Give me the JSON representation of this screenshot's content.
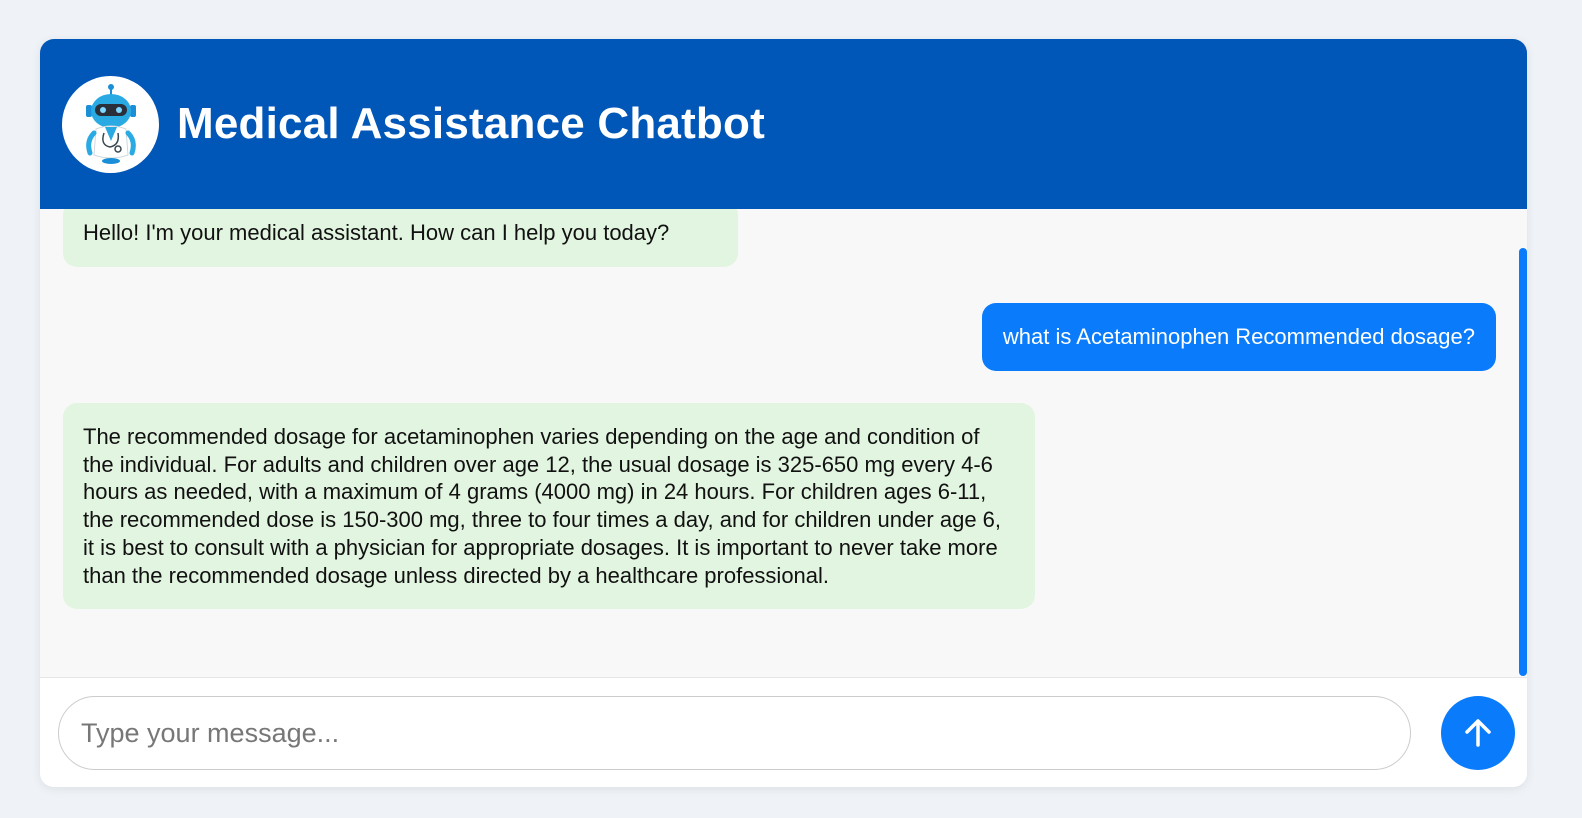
{
  "header": {
    "title": "Medical Assistance Chatbot",
    "avatar_icon": "robot-doctor-icon"
  },
  "messages": [
    {
      "role": "bot",
      "text": "Hello! I'm your medical assistant. How can I help you today?"
    },
    {
      "role": "user",
      "text": "what is Acetaminophen Recommended dosage?"
    },
    {
      "role": "bot",
      "text": "The recommended dosage for acetaminophen varies depending on the age and condition of the individual. For adults and children over age 12, the usual dosage is 325-650 mg every 4-6 hours as needed, with a maximum of 4 grams (4000 mg) in 24 hours. For children ages 6-11, the recommended dose is 150-300 mg, three to four times a day, and for children under age 6, it is best to consult with a physician for appropriate dosages. It is important to never take more than the recommended dosage unless directed by a healthcare professional."
    }
  ],
  "input": {
    "placeholder": "Type your message...",
    "value": ""
  },
  "send_button": {
    "icon": "arrow-up-icon"
  },
  "colors": {
    "header_bg": "#0057b8",
    "bot_bubble": "#e2f5e0",
    "user_bubble": "#0a7cfb",
    "accent": "#0a7cfb",
    "page_bg": "#eff3f7"
  }
}
